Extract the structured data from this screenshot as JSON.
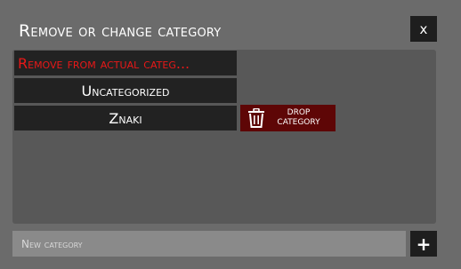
{
  "dialog": {
    "title": "Remove or change category",
    "close_label": "x"
  },
  "categories": [
    {
      "label": "Remove from actual categ...",
      "color": "#e81818"
    },
    {
      "label": "Uncategorized"
    },
    {
      "label": "Znaki"
    }
  ],
  "drop_category": {
    "icon": "trash-icon",
    "label_line1": "DROP",
    "label_line2": "CATEGORY",
    "color": "#5e0606"
  },
  "new_category": {
    "placeholder": "New category",
    "value": "",
    "add_label": "+"
  }
}
